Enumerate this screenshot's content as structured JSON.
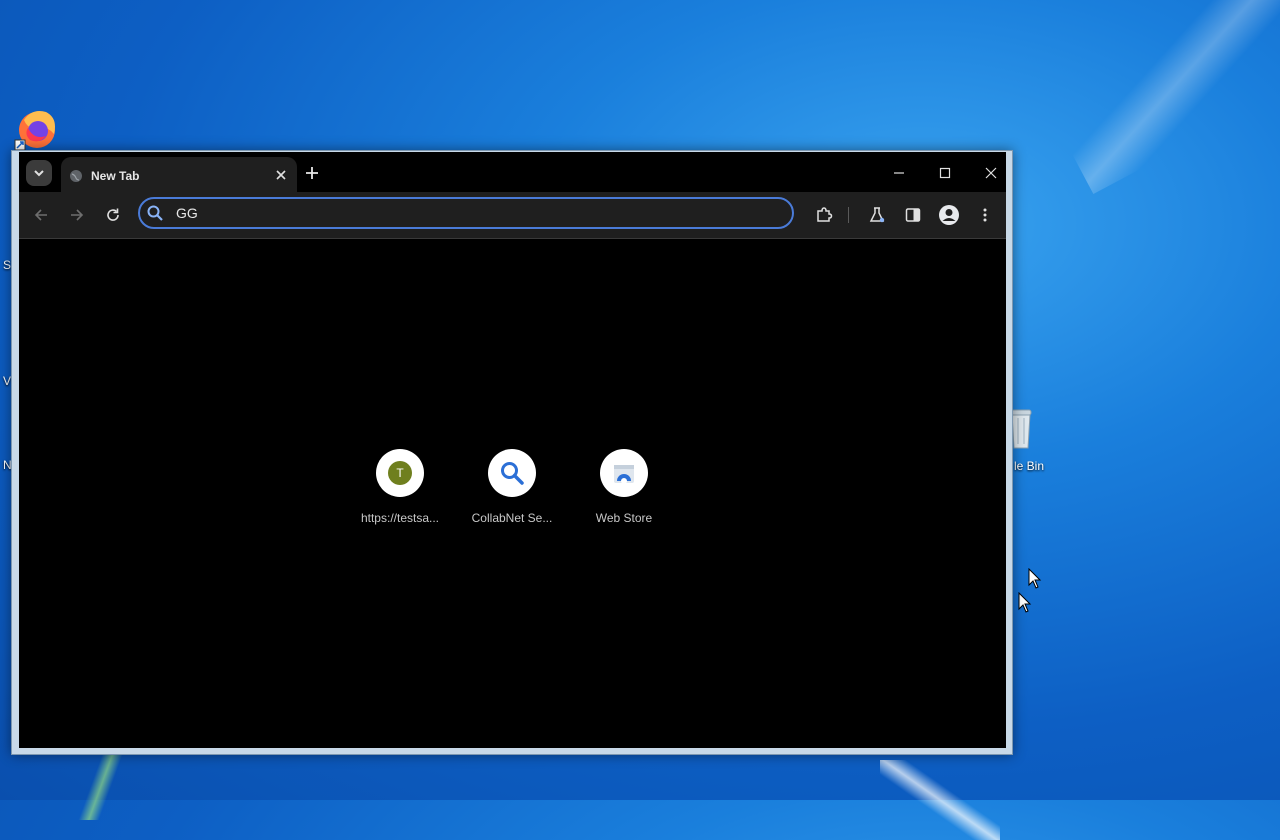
{
  "desktop": {
    "icons": [
      {
        "name": "Firefox"
      },
      {
        "name": "Recycle Bin",
        "visible_label": "le Bin"
      }
    ],
    "edge_letters": [
      "S",
      "V",
      "N"
    ]
  },
  "browser": {
    "tabs": [
      {
        "title": "New Tab",
        "active": true
      }
    ],
    "omnibox": {
      "value": "GG"
    },
    "shortcuts": [
      {
        "label": "https://testsa...",
        "icon_letter": "T",
        "badge_color": "#6f7f1e"
      },
      {
        "label": "CollabNet Se...",
        "icon": "search-icon"
      },
      {
        "label": "Web Store",
        "icon": "web-store-icon"
      }
    ],
    "theme": {
      "accent": "#4a7bd8",
      "background": "#000000",
      "toolbar": "#1f1f1f"
    }
  }
}
